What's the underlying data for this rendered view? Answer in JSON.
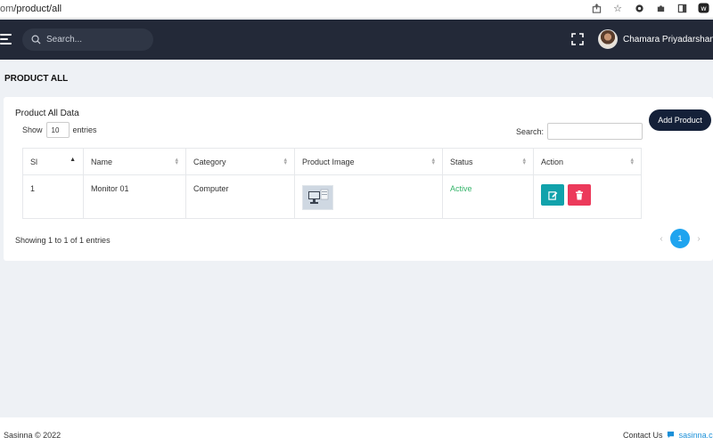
{
  "browser": {
    "url_host": "om",
    "url_path": "/product/all"
  },
  "header": {
    "search_placeholder": "Search...",
    "user_name": "Chamara Priyadarshana"
  },
  "page": {
    "title": "PRODUCT ALL"
  },
  "card": {
    "title": "Product All Data",
    "add_button": "Add Product",
    "show_label": "Show",
    "entries_value": "10",
    "entries_label": "entries",
    "search_label": "Search:"
  },
  "table": {
    "columns": [
      "Sl",
      "Name",
      "Category",
      "Product Image",
      "Status",
      "Action"
    ],
    "rows": [
      {
        "sl": "1",
        "name": "Monitor 01",
        "category": "Computer",
        "image": "monitor-thumbnail",
        "status": "Active"
      }
    ]
  },
  "pagination": {
    "info": "Showing 1 to 1 of 1 entries",
    "prev": "‹",
    "current": "1",
    "next": "›"
  },
  "footer": {
    "copyright": "Sasinna © 2022",
    "contact_label": "Contact Us",
    "contact_link": "sasinna.co"
  },
  "colors": {
    "header_bg": "#232938",
    "add_button_bg": "#142038",
    "edit_button": "#11a2ab",
    "delete_button": "#ec3a5b",
    "status_active": "#35b46a",
    "page_active": "#1fa4ef"
  }
}
